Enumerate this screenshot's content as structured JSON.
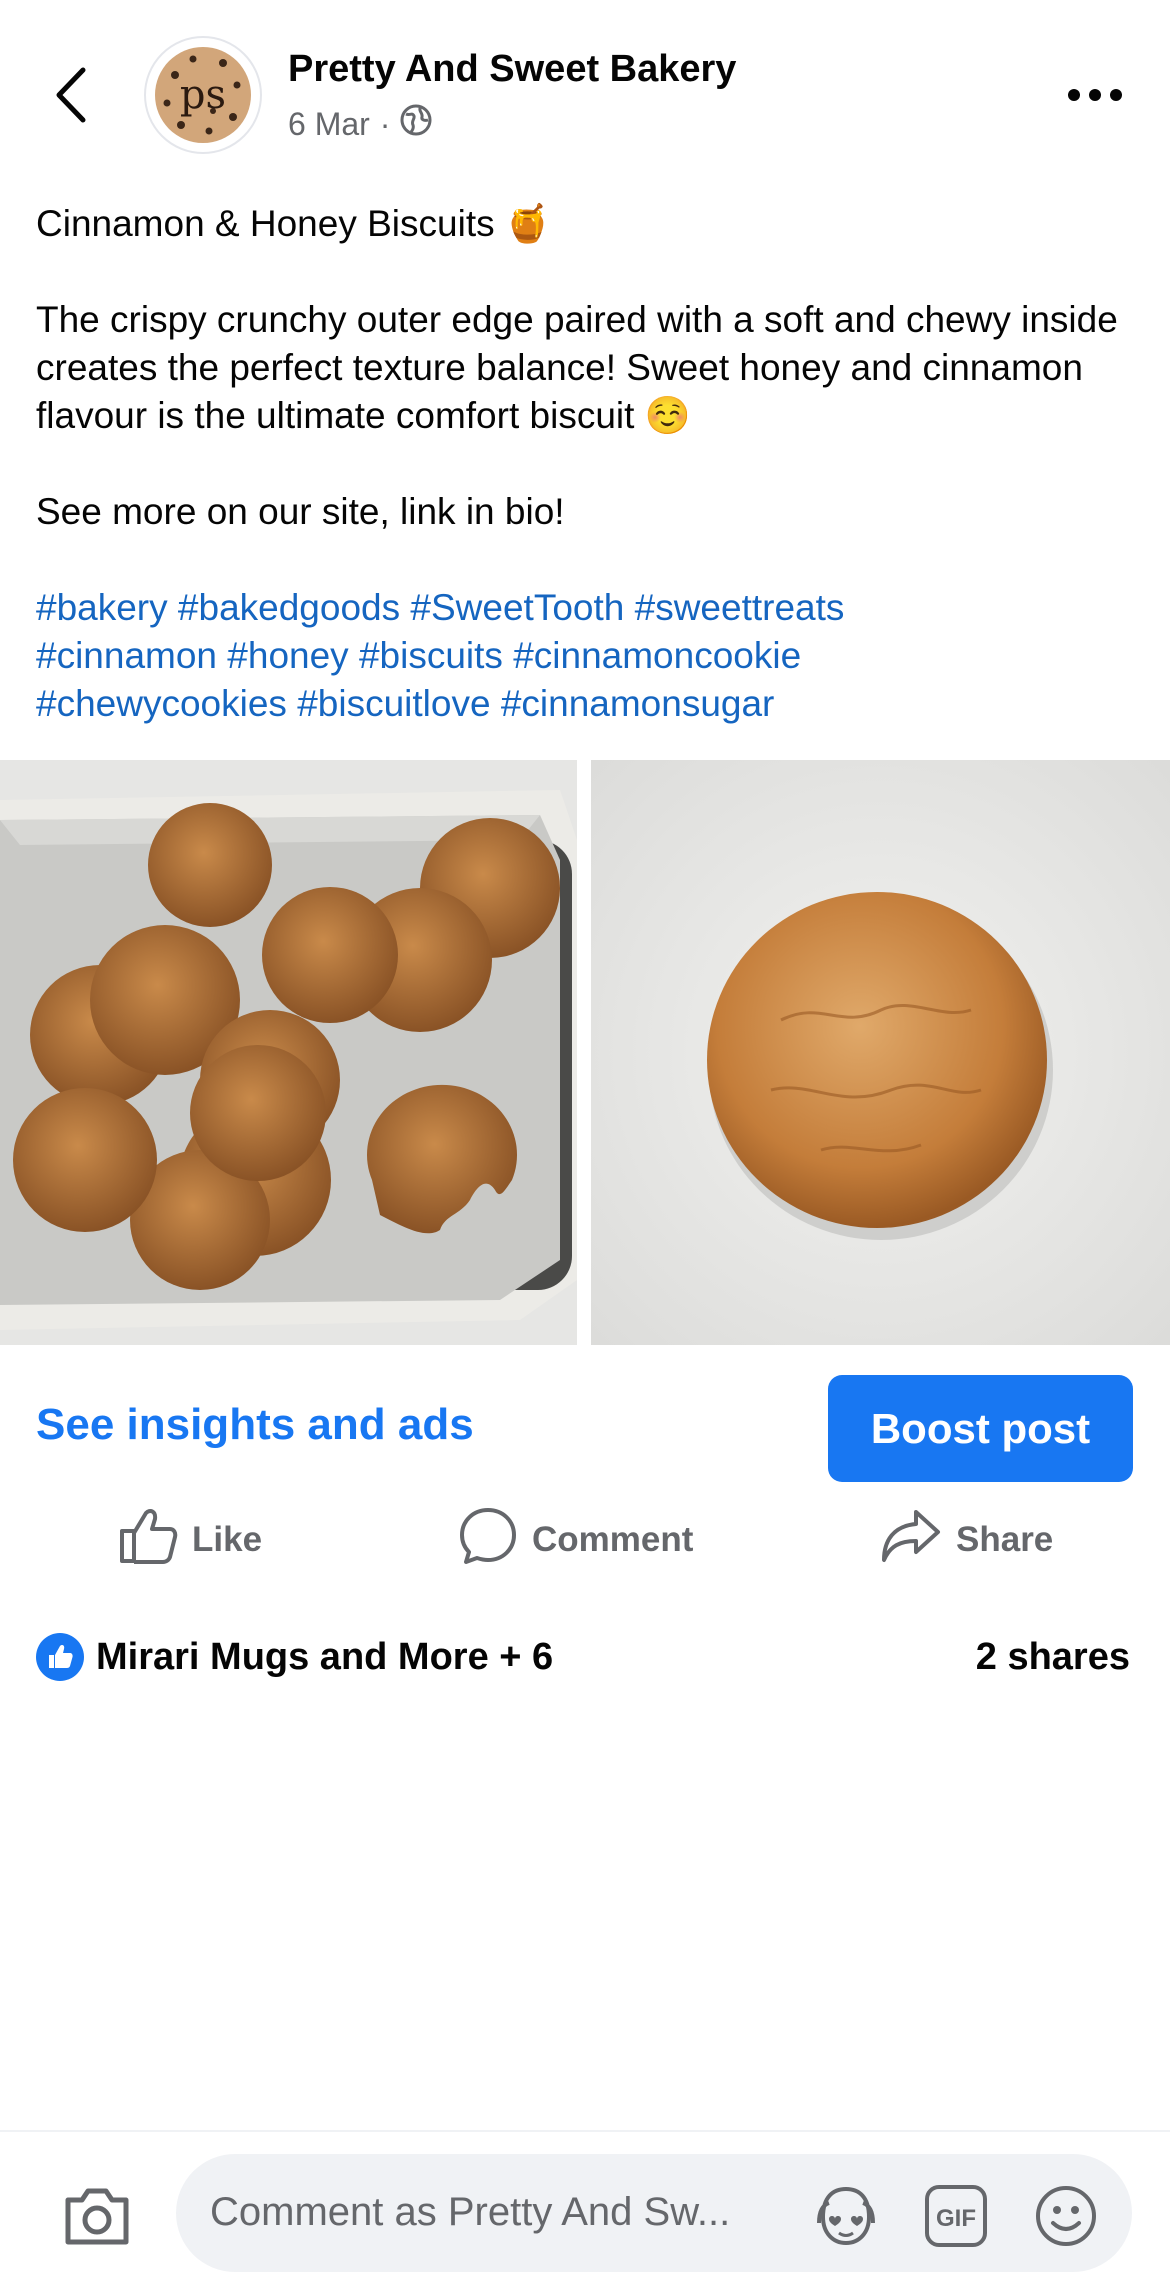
{
  "header": {
    "page_name": "Pretty And Sweet Bakery",
    "avatar_text": "ps",
    "date": "6 Mar",
    "separator": "·",
    "audience_icon": "globe-icon"
  },
  "post": {
    "title": "Cinnamon & Honey Biscuits 🍯",
    "body": "The crispy crunchy outer edge paired with a soft and chewy inside creates the perfect texture balance! Sweet honey and cinnamon flavour is the ultimate comfort biscuit ☺️",
    "cta": "See more on our site, link in bio!",
    "hashtags": [
      "#bakery",
      "#bakedgoods",
      "#SweetTooth",
      "#sweettreats",
      "#cinnamon",
      "#honey",
      "#biscuits",
      "#cinnamoncookie",
      "#chewycookies",
      "#biscuitlove",
      "#cinnamonsugar"
    ]
  },
  "insights": {
    "link_label": "See insights and ads",
    "boost_label": "Boost post"
  },
  "actions": {
    "like": "Like",
    "comment": "Comment",
    "share": "Share"
  },
  "reactions": {
    "summary": "Mirari Mugs and More + 6",
    "shares": "2 shares"
  },
  "comment_bar": {
    "placeholder": "Comment as Pretty And Sw..."
  },
  "colors": {
    "accent": "#1877f2",
    "hashtag": "#1565c0",
    "secondary_text": "#65676b"
  }
}
